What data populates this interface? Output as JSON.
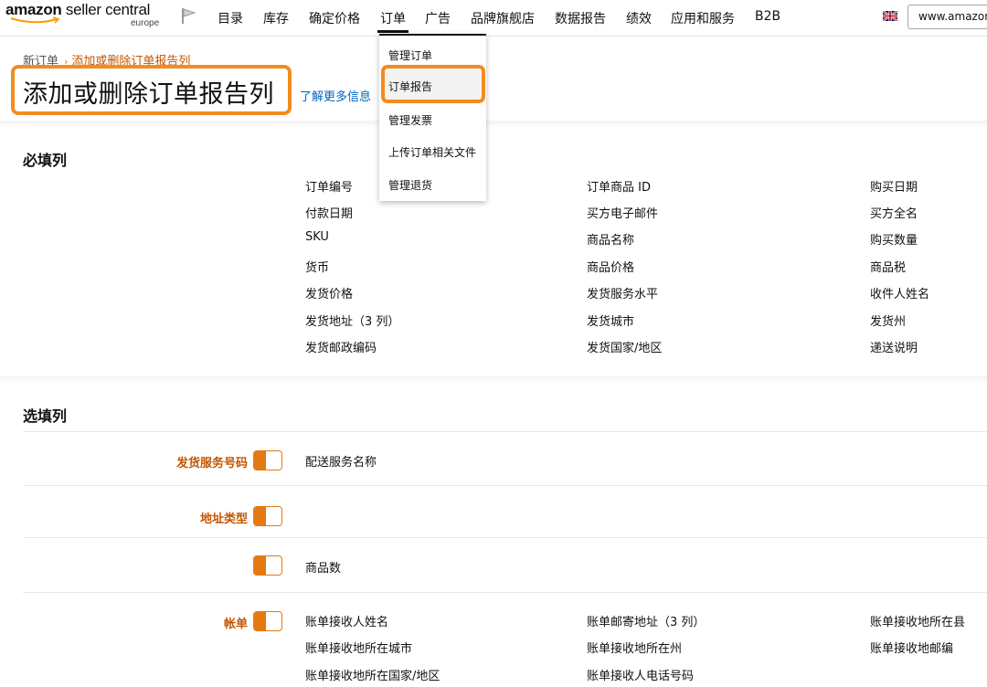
{
  "colors": {
    "accent_orange": "#e47911",
    "highlight_orange": "#f28c1e",
    "link_blue": "#0066c0",
    "label_orange": "#c45500"
  },
  "header": {
    "logo_brand": "amazon",
    "logo_product": " seller central",
    "logo_region": "europe",
    "flag_icon": "flag-icon",
    "nav": [
      "目录",
      "库存",
      "确定价格",
      "订单",
      "广告",
      "品牌旗舰店",
      "数据报告",
      "绩效",
      "应用和服务",
      "B2B"
    ],
    "active_nav": "订单",
    "marketplace_icon": "uk-flag-icon",
    "marketplace": "www.amazon.co.uk"
  },
  "orders_menu": {
    "items": [
      "管理订单",
      "订单报告",
      "管理发票",
      "上传订单相关文件",
      "管理退货"
    ],
    "selected": "订单报告"
  },
  "breadcrumb": {
    "parent": "新订单",
    "separator": "›",
    "current": "添加或删除订单报告列"
  },
  "page": {
    "title": "添加或删除订单报告列",
    "learn_more": "了解更多信息"
  },
  "required": {
    "heading": "必填列",
    "columns": [
      [
        "订单编号",
        "付款日期",
        "SKU",
        "货币",
        "发货价格",
        "发货地址（3 列）",
        "发货邮政编码"
      ],
      [
        "订单商品 ID",
        "买方电子邮件",
        "商品名称",
        "商品价格",
        "发货服务水平",
        "发货城市",
        "发货国家/地区"
      ],
      [
        "购买日期",
        "买方全名",
        "购买数量",
        "商品税",
        "收件人姓名",
        "发货州",
        "递送说明"
      ]
    ]
  },
  "optional": {
    "heading": "选填列",
    "rows": [
      {
        "label": "发货服务号码",
        "fields": [
          "配送服务名称"
        ]
      },
      {
        "label": "地址类型",
        "fields": []
      },
      {
        "label": "",
        "fields": [
          "商品数"
        ]
      },
      {
        "label": "帐单",
        "fields": [
          "账单接收人姓名",
          "账单邮寄地址（3 列）",
          "账单接收地所在县",
          "账单接收地所在城市",
          "账单接收地所在州",
          "账单接收地邮编",
          "账单接收地所在国家/地区",
          "账单接收人电话号码"
        ]
      }
    ]
  }
}
